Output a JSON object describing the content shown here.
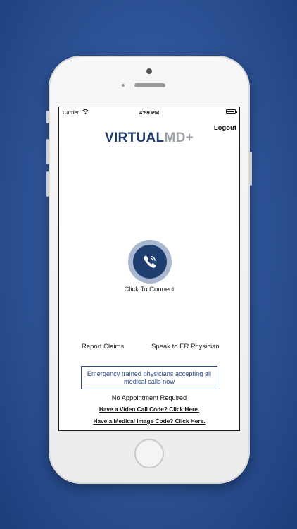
{
  "status_bar": {
    "carrier": "Carrier",
    "time": "4:59 PM"
  },
  "header": {
    "logo_part1": "VIRTUAL",
    "logo_part2": "MD+",
    "logout_label": "Logout"
  },
  "call": {
    "label": "Click To Connect"
  },
  "actions": {
    "report_claims": "Report Claims",
    "speak_er": "Speak to ER Physician"
  },
  "banner": {
    "text": "Emergency trained physicians accepting all medical calls now"
  },
  "footer": {
    "no_appointment": "No Appointment Required",
    "video_code": "Have a Video Call Code? Click Here.",
    "image_code": "Have a Medical Image Code? Click Here."
  },
  "colors": {
    "brand_navy": "#1f3e70",
    "brand_gray": "#9fa3a9",
    "ring": "#a9b7d0",
    "background": "#30569a"
  }
}
